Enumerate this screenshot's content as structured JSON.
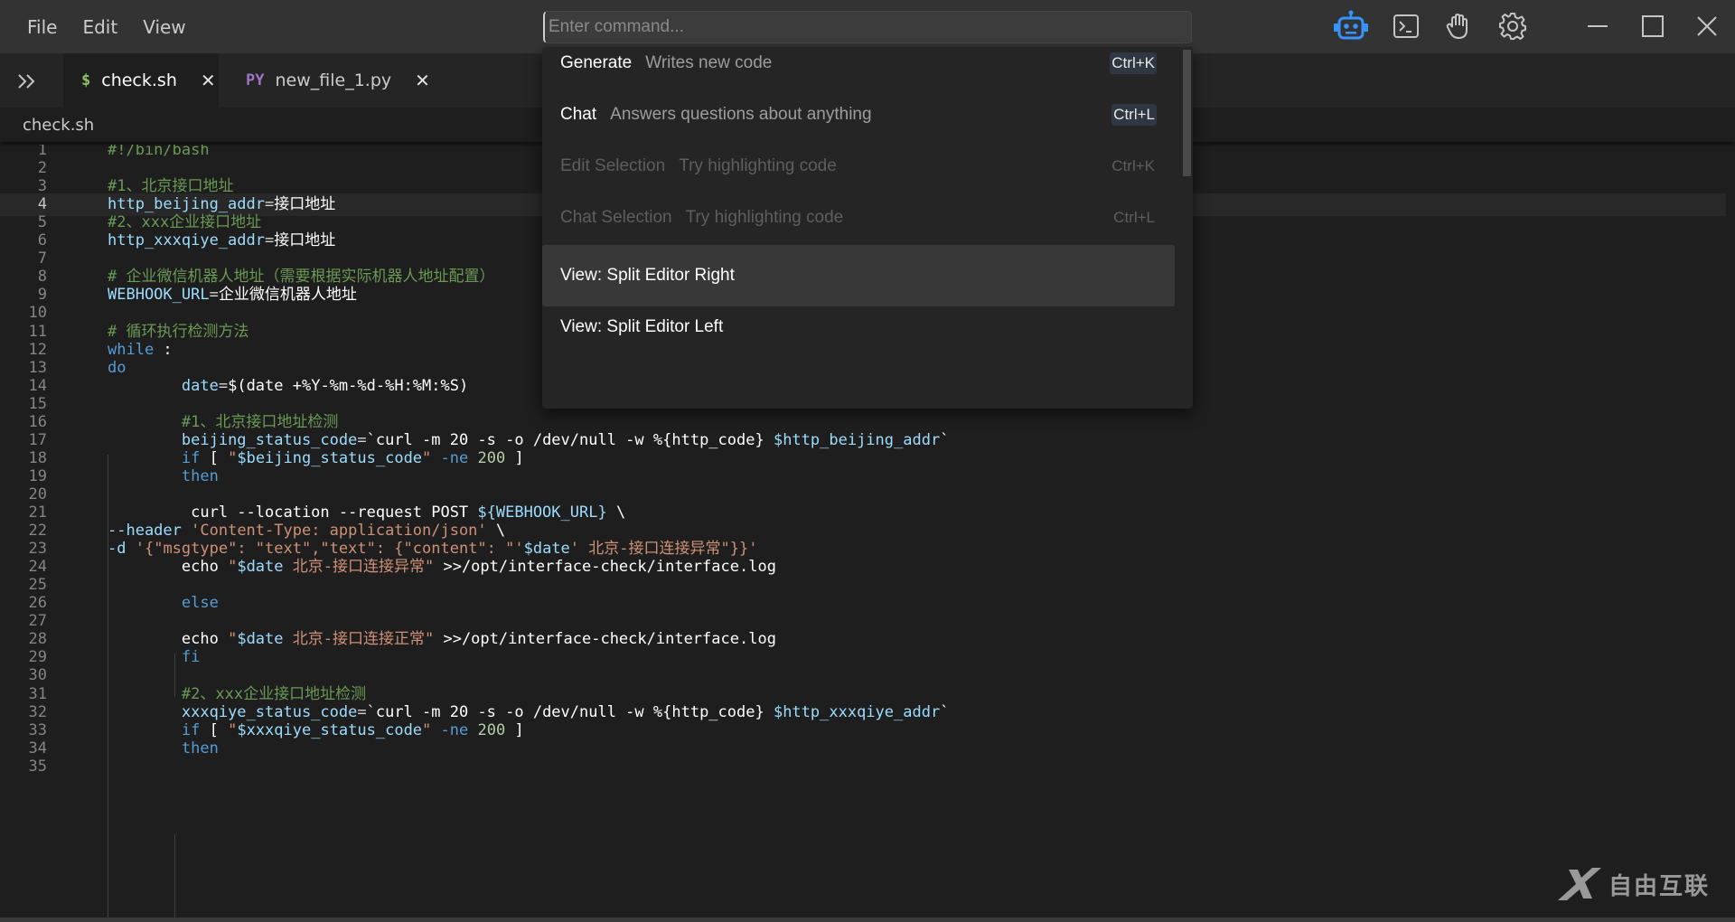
{
  "menu": {
    "file": "File",
    "edit": "Edit",
    "view": "View"
  },
  "command": {
    "placeholder": "Enter command..."
  },
  "toolbar": {
    "icons": [
      "robot-icon",
      "terminal-icon",
      "hand-icon",
      "gear-icon"
    ],
    "accent": "#3794ff"
  },
  "tabs": [
    {
      "icon": "$",
      "icon_color": "#8cc265",
      "label": "check.sh",
      "close": "✕",
      "active": true
    },
    {
      "icon": "PY",
      "icon_color": "#a074c4",
      "label": "new_file_1.py",
      "close": "✕",
      "active": false
    }
  ],
  "breadcrumb": "check.sh",
  "palette": {
    "items": [
      {
        "name": "Generate",
        "desc": "Writes new code",
        "key": "Ctrl+K",
        "enabled": true
      },
      {
        "name": "Chat",
        "desc": "Answers questions about anything",
        "key": "Ctrl+L",
        "enabled": true
      },
      {
        "name": "Edit Selection",
        "desc": "Try highlighting code",
        "key": "Ctrl+K",
        "enabled": false
      },
      {
        "name": "Chat Selection",
        "desc": "Try highlighting code",
        "key": "Ctrl+L",
        "enabled": false
      },
      {
        "name": "View: Split Editor Right",
        "desc": "",
        "key": "",
        "enabled": true,
        "selected": true
      },
      {
        "name": "View: Split Editor Left",
        "desc": "",
        "key": "",
        "enabled": true
      }
    ]
  },
  "editor": {
    "current_line": 4,
    "lines": [
      {
        "n": "1",
        "t": [
          [
            "c",
            "#!/bin/bash"
          ]
        ]
      },
      {
        "n": "2",
        "t": []
      },
      {
        "n": "3",
        "t": [
          [
            "c",
            "#1、北京接口地址"
          ]
        ]
      },
      {
        "n": "4",
        "t": [
          [
            "v",
            "http_beijing_addr"
          ],
          [
            "o",
            "="
          ],
          [
            "w",
            "接口地址"
          ]
        ]
      },
      {
        "n": "5",
        "t": [
          [
            "c",
            "#2、xxx企业接口地址"
          ]
        ]
      },
      {
        "n": "6",
        "t": [
          [
            "v",
            "http_xxxqiye_addr"
          ],
          [
            "o",
            "="
          ],
          [
            "w",
            "接口地址"
          ]
        ]
      },
      {
        "n": "7",
        "t": []
      },
      {
        "n": "8",
        "t": [
          [
            "c",
            "# 企业微信机器人地址（需要根据实际机器人地址配置）"
          ]
        ]
      },
      {
        "n": "9",
        "t": [
          [
            "v",
            "WEBHOOK_URL"
          ],
          [
            "o",
            "="
          ],
          [
            "w",
            "企业微信机器人地址"
          ]
        ]
      },
      {
        "n": "10",
        "t": []
      },
      {
        "n": "11",
        "t": [
          [
            "c",
            "# 循环执行检测方法"
          ]
        ]
      },
      {
        "n": "12",
        "t": [
          [
            "k",
            "while"
          ],
          [
            "w",
            " :"
          ]
        ]
      },
      {
        "n": "13",
        "t": [
          [
            "k",
            "do"
          ]
        ]
      },
      {
        "n": "14",
        "t": [
          [
            "o",
            "        "
          ],
          [
            "v",
            "date"
          ],
          [
            "o",
            "="
          ],
          [
            "w",
            "$(date +%Y-%m-%d-%H:%M:%S)"
          ]
        ]
      },
      {
        "n": "15",
        "t": []
      },
      {
        "n": "16",
        "t": [
          [
            "o",
            "        "
          ],
          [
            "c",
            "#1、北京接口地址检测"
          ]
        ]
      },
      {
        "n": "17",
        "t": [
          [
            "o",
            "        "
          ],
          [
            "v",
            "beijing_status_code"
          ],
          [
            "o",
            "="
          ],
          [
            "w",
            "`curl -m 20 -s -o /dev/null -w %{http_code} "
          ],
          [
            "v",
            "$http_beijing_addr"
          ],
          [
            "w",
            "`"
          ]
        ]
      },
      {
        "n": "18",
        "t": [
          [
            "o",
            "        "
          ],
          [
            "k",
            "if"
          ],
          [
            "w",
            " [ "
          ],
          [
            "s",
            "\""
          ],
          [
            "v",
            "$beijing_status_code"
          ],
          [
            "s",
            "\""
          ],
          [
            "w",
            " "
          ],
          [
            "k",
            "-ne"
          ],
          [
            "w",
            " "
          ],
          [
            "n",
            "200"
          ],
          [
            "w",
            " ]"
          ]
        ]
      },
      {
        "n": "19",
        "t": [
          [
            "o",
            "        "
          ],
          [
            "k",
            "then"
          ]
        ]
      },
      {
        "n": "20",
        "t": []
      },
      {
        "n": "21",
        "t": [
          [
            "o",
            "         "
          ],
          [
            "w",
            "curl --location --request POST "
          ],
          [
            "v",
            "${WEBHOOK_URL}"
          ],
          [
            "w",
            " \\"
          ]
        ]
      },
      {
        "n": "22",
        "t": [
          [
            "v",
            "--header"
          ],
          [
            "w",
            " "
          ],
          [
            "s",
            "'Content-Type: application/json'"
          ],
          [
            "w",
            " \\"
          ]
        ]
      },
      {
        "n": "23",
        "t": [
          [
            "v",
            "-d"
          ],
          [
            "w",
            " "
          ],
          [
            "s",
            "'{\"msgtype\": \"text\",\"text\": {\"content\": \"'"
          ],
          [
            "v",
            "$date"
          ],
          [
            "s",
            "' 北京-接口连接异常\"}}'"
          ]
        ]
      },
      {
        "n": "24",
        "t": [
          [
            "o",
            "        "
          ],
          [
            "w",
            "echo "
          ],
          [
            "s",
            "\""
          ],
          [
            "v",
            "$date"
          ],
          [
            "s",
            " 北京-接口连接异常\""
          ],
          [
            "w",
            " >>/opt/interface-check/interface.log"
          ]
        ]
      },
      {
        "n": "25",
        "t": []
      },
      {
        "n": "26",
        "t": [
          [
            "o",
            "        "
          ],
          [
            "k",
            "else"
          ]
        ]
      },
      {
        "n": "27",
        "t": []
      },
      {
        "n": "28",
        "t": [
          [
            "o",
            "        "
          ],
          [
            "w",
            "echo "
          ],
          [
            "s",
            "\""
          ],
          [
            "v",
            "$date"
          ],
          [
            "s",
            " 北京-接口连接正常\""
          ],
          [
            "w",
            " >>/opt/interface-check/interface.log"
          ]
        ]
      },
      {
        "n": "29",
        "t": [
          [
            "o",
            "        "
          ],
          [
            "k",
            "fi"
          ]
        ]
      },
      {
        "n": "30",
        "t": []
      },
      {
        "n": "31",
        "t": [
          [
            "o",
            "        "
          ],
          [
            "c",
            "#2、xxx企业接口地址检测"
          ]
        ]
      },
      {
        "n": "32",
        "t": [
          [
            "o",
            "        "
          ],
          [
            "v",
            "xxxqiye_status_code"
          ],
          [
            "o",
            "="
          ],
          [
            "w",
            "`curl -m 20 -s -o /dev/null -w %{http_code} "
          ],
          [
            "v",
            "$http_xxxqiye_addr"
          ],
          [
            "w",
            "`"
          ]
        ]
      },
      {
        "n": "33",
        "t": [
          [
            "o",
            "        "
          ],
          [
            "k",
            "if"
          ],
          [
            "w",
            " [ "
          ],
          [
            "s",
            "\""
          ],
          [
            "v",
            "$xxxqiye_status_code"
          ],
          [
            "s",
            "\""
          ],
          [
            "w",
            " "
          ],
          [
            "k",
            "-ne"
          ],
          [
            "w",
            " "
          ],
          [
            "n",
            "200"
          ],
          [
            "w",
            " ]"
          ]
        ]
      },
      {
        "n": "34",
        "t": [
          [
            "o",
            "        "
          ],
          [
            "k",
            "then"
          ]
        ]
      },
      {
        "n": "35",
        "t": []
      }
    ]
  },
  "watermark": "自由互联"
}
